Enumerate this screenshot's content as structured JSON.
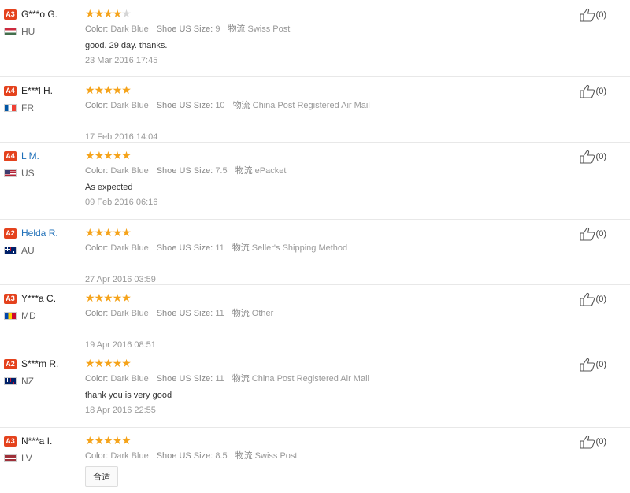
{
  "colors": {
    "star_on": "#f5a31a",
    "star_off": "#d5d5d5",
    "level_badge": "#e4421d",
    "link_name": "#1e6fb8"
  },
  "labels": {
    "color": "Color:",
    "size": "Shoe US Size:",
    "shipping": "物流"
  },
  "reviews": [
    {
      "level": "A3",
      "name": "G***o G.",
      "name_link": false,
      "country": "HU",
      "flag": "hu",
      "rating": 4,
      "color": "Dark Blue",
      "size": "9",
      "shipping": "Swiss Post",
      "text": "good. 29 day. thanks.",
      "date": "23 Mar 2016 17:45",
      "tag": "",
      "helpful": "(0)"
    },
    {
      "level": "A4",
      "name": "E***l H.",
      "name_link": false,
      "country": "FR",
      "flag": "fr",
      "rating": 5,
      "color": "Dark Blue",
      "size": "10",
      "shipping": "China Post Registered Air Mail",
      "text": "",
      "date": "17 Feb 2016 14:04",
      "tag": "",
      "helpful": "(0)"
    },
    {
      "level": "A4",
      "name": "L M.",
      "name_link": true,
      "country": "US",
      "flag": "us",
      "rating": 5,
      "color": "Dark Blue",
      "size": "7.5",
      "shipping": "ePacket",
      "text": "As expected",
      "date": "09 Feb 2016 06:16",
      "tag": "",
      "helpful": "(0)"
    },
    {
      "level": "A2",
      "name": "Helda R.",
      "name_link": true,
      "country": "AU",
      "flag": "au",
      "rating": 5,
      "color": "Dark Blue",
      "size": "11",
      "shipping": "Seller's Shipping Method",
      "text": "",
      "date": "27 Apr 2016 03:59",
      "tag": "",
      "helpful": "(0)"
    },
    {
      "level": "A3",
      "name": "Y***a C.",
      "name_link": false,
      "country": "MD",
      "flag": "md",
      "rating": 5,
      "color": "Dark Blue",
      "size": "11",
      "shipping": "Other",
      "text": "",
      "date": "19 Apr 2016 08:51",
      "tag": "",
      "helpful": "(0)"
    },
    {
      "level": "A2",
      "name": "S***m R.",
      "name_link": false,
      "country": "NZ",
      "flag": "nz",
      "rating": 5,
      "color": "Dark Blue",
      "size": "11",
      "shipping": "China Post Registered Air Mail",
      "text": "thank you is very good",
      "date": "18 Apr 2016 22:55",
      "tag": "",
      "helpful": "(0)"
    },
    {
      "level": "A3",
      "name": "N***a I.",
      "name_link": false,
      "country": "LV",
      "flag": "lv",
      "rating": 5,
      "color": "Dark Blue",
      "size": "8.5",
      "shipping": "Swiss Post",
      "text": "",
      "date": "",
      "tag": "合适",
      "helpful": "(0)"
    }
  ]
}
